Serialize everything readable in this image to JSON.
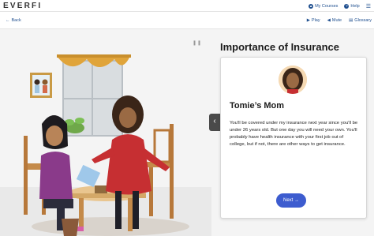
{
  "app": {
    "logo": "EVERFI"
  },
  "topnav": {
    "courses": "My Courses",
    "help": "Help"
  },
  "toolbar": {
    "back": "Back",
    "play": "Play",
    "mute": "Mute",
    "glossary": "Glossary"
  },
  "panel": {
    "title": "Importance of Insurance",
    "speaker": "Tomie’s Mom",
    "text": "You'll be covered under my insurance next year since you'll be under 26 years old. But one day you will need your own. You'll probably have health insurance with your first job out of college, but if not, there are other ways to get insurance.",
    "next": "Next"
  },
  "icons": {
    "back": "arrow-left-icon",
    "play": "play-icon",
    "mute": "speaker-icon",
    "glossary": "book-icon",
    "courses": "graduation-cap-icon",
    "help": "help-icon",
    "collapse": "chevron-left-icon",
    "next": "arrow-right-icon",
    "pause": "pause-icon"
  },
  "colors": {
    "accent": "#3d5ccf",
    "link": "#1f4f8f"
  }
}
